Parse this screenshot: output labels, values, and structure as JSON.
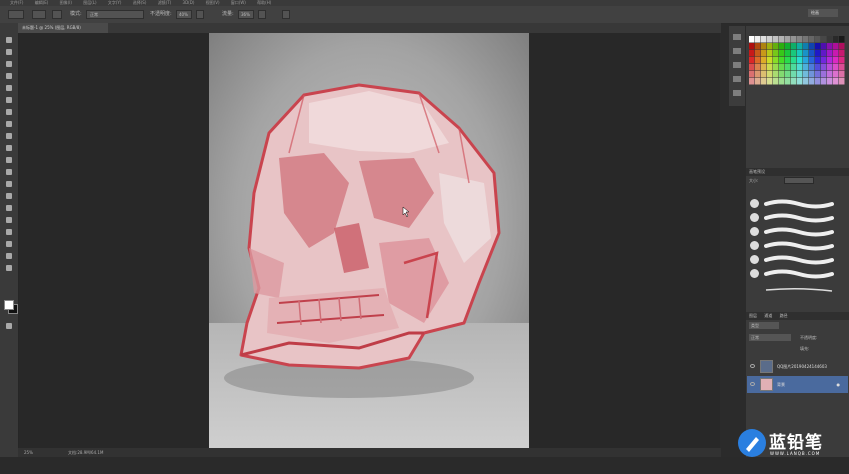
{
  "menu": [
    "文件(F)",
    "编辑(E)",
    "图像(I)",
    "图层(L)",
    "文字(Y)",
    "选择(S)",
    "滤镜(T)",
    "3D(D)",
    "视图(V)",
    "窗口(W)",
    "帮助(H)"
  ],
  "options": {
    "mode_label": "模式:",
    "mode_value": "正常",
    "opacity_label": "不透明度:",
    "opacity_value": "40%",
    "flow_label": "流量:",
    "flow_value": "36%"
  },
  "workspace_select": "绘画",
  "document_tab": "未标题-1 @ 25% (图层, RGB/8)",
  "status": {
    "zoom": "25%",
    "doc_size": "文档:28.9M/64.1M"
  },
  "panels": {
    "brush_title": "画笔预设",
    "brush_size_label": "大小:",
    "layers_tabs": [
      "图层",
      "通道",
      "路径"
    ],
    "filter_kind": "类型",
    "blend_mode": "正常",
    "opacity_label": "不透明度:",
    "fill_label": "填充:"
  },
  "layers": [
    {
      "name": "QQ图片20190424144603",
      "selected": false
    },
    {
      "name": "背景",
      "selected": true
    }
  ],
  "watermark": {
    "name": "蓝铅笔",
    "url": "WWW.LANQB.COM"
  },
  "colors": {
    "skull_red": "#d25a62",
    "bg_gray": "#9a9a9a",
    "layer_selected": "#4a6a9e",
    "logo_blue": "#2a7fe0"
  }
}
